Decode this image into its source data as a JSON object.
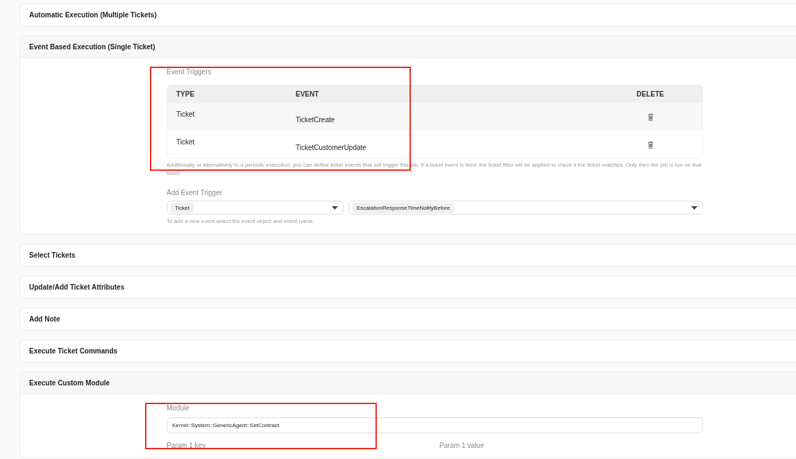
{
  "sections": [
    {
      "title": "Automatic Execution (Multiple Tickets)",
      "expanded": false
    },
    {
      "title": "Event Based Execution (Single Ticket)",
      "expanded": true,
      "kind": "event_triggers",
      "triggers_label": "Event Triggers",
      "highlighted": true,
      "columns": [
        "TYPE",
        "EVENT",
        "DELETE"
      ],
      "rows": [
        {
          "type": "Ticket",
          "event": "TicketCreate"
        },
        {
          "type": "Ticket",
          "event": "TicketCustomerUpdate"
        }
      ],
      "hint": "Additionally or alternatively to a periodic execution, you can define ticket events that will trigger this job. If a ticket event is fired, the ticket filter will be applied to check if the ticket matches. Only then the job is run on that ticket.",
      "add_label": "Add Event Trigger",
      "object_value": "Ticket",
      "event_value": "EscalationResponseTimeNotifyBefore",
      "add_hint": "To add a new event select the event object and event name."
    },
    {
      "title": "Select Tickets",
      "expanded": false
    },
    {
      "title": "Update/Add Ticket Attributes",
      "expanded": false
    },
    {
      "title": "Add Note",
      "expanded": false
    },
    {
      "title": "Execute Ticket Commands",
      "expanded": false
    },
    {
      "title": "Execute Custom Module",
      "expanded": true,
      "kind": "module",
      "module_label": "Module",
      "module_value": "Kernel::System::GenericAgent::SetContract",
      "highlighted": true,
      "param_key_label": "Param 1 key",
      "param_value_label": "Param 1 value"
    }
  ]
}
